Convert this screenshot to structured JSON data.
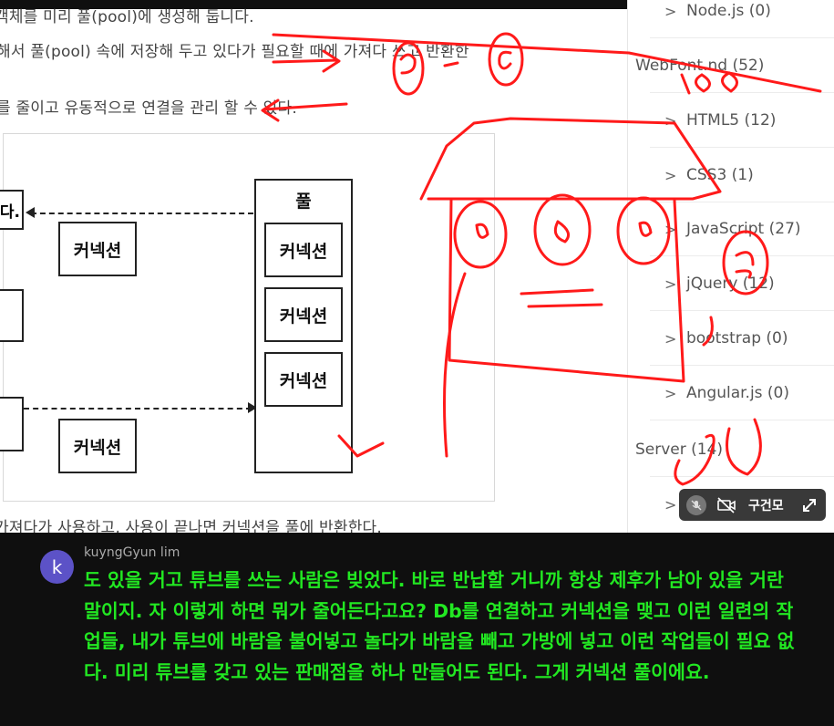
{
  "article": {
    "lines": [
      "객체를 미리 풀(pool)에 생성해 둡니다.",
      "해서 풀(pool) 속에 저장해 두고 있다가 필요할 때에 가져다 쓰고 반환한",
      "를 줄이고 유동적으로 연결을 관리 할 수 있다.",
      "가져다가 사용하고, 사용이 끝나면 커넥션을 풀에 반환한다."
    ]
  },
  "diagram": {
    "left_stub_text": "다.",
    "pool_title": "풀",
    "connection_label": "커넥션"
  },
  "sidebar": {
    "items": [
      {
        "label": "Node.js (0)",
        "type": "sub"
      },
      {
        "label": "WebFont.nd (52)",
        "type": "category"
      },
      {
        "label": "HTML5 (12)",
        "type": "sub"
      },
      {
        "label": "CSS3 (1)",
        "type": "sub"
      },
      {
        "label": "JavaScript (27)",
        "type": "sub"
      },
      {
        "label": "jQuery (12)",
        "type": "sub"
      },
      {
        "label": "bootstrap (0)",
        "type": "sub"
      },
      {
        "label": "Angular.js (0)",
        "type": "sub"
      },
      {
        "label": "Server (14)",
        "type": "category"
      }
    ],
    "chevron": ">"
  },
  "call_pill": {
    "name": "구건모",
    "icons": [
      "mic-muted-icon",
      "camera-off-icon",
      "expand-icon"
    ]
  },
  "chat": {
    "avatar_letter": "k",
    "username": "kuyngGyun lim",
    "message": "도 있을 거고 튜브를 쓰는 사람은 빚었다. 바로 반납할 거니까 항상 제후가 남아 있을 거란 말이지. 자 이렇게 하면 뭐가 줄어든다고요? Db를 연결하고 커넥션을 맺고 이런 일련의 작업들, 내가 튜브에 바람을 불어넣고 놀다가 바람을 빼고 가방에 넣고 이런 작업들이 필요 없다. 미리 튜브를 갖고 있는 판매점을 하나 만들어도 된다. 그게 커넥션 풀이에요.",
    "message_color": "#22e822"
  },
  "colors": {
    "annotation": "#ff1a1a",
    "avatar": "#5c52c7"
  }
}
